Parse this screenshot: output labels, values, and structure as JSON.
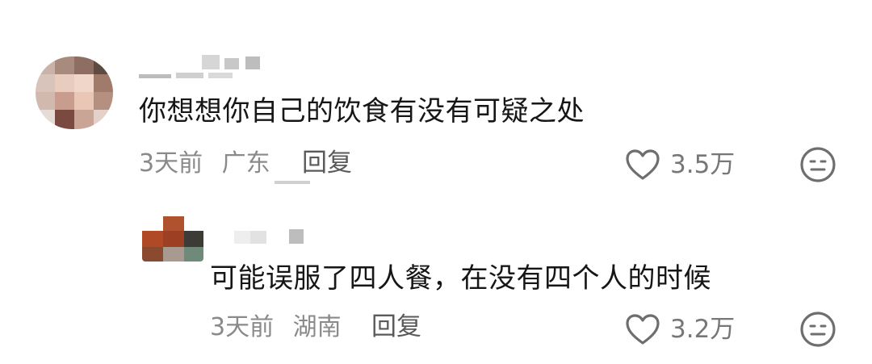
{
  "comments": [
    {
      "text": "你想想你自己的饮食有没有可疑之处",
      "date": "3天前",
      "location": "广东",
      "reply_label": "回复",
      "likes": "3.5万"
    },
    {
      "text": "可能误服了四人餐，在没有四个人的时候",
      "date": "3天前",
      "location": "湖南",
      "reply_label": "回复",
      "likes": "3.2万"
    }
  ],
  "icons": {
    "like": "heart-outline-icon",
    "dislike": "neutral-face-icon"
  },
  "colors": {
    "text": "#161616",
    "meta": "#8a8a8a",
    "icon": "#6e6e6e"
  }
}
